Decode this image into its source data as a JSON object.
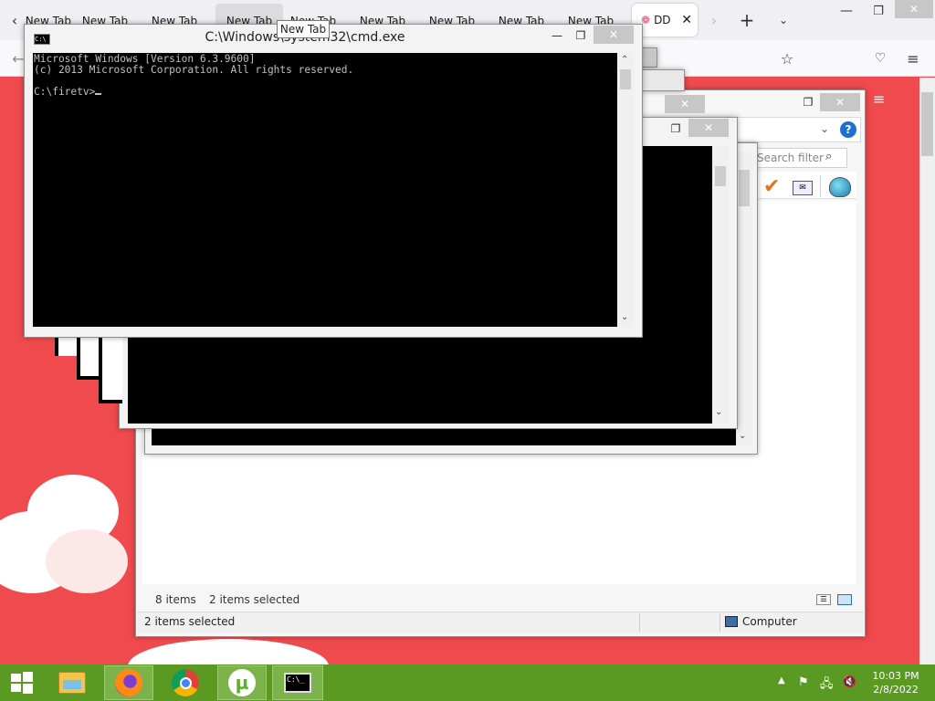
{
  "browser": {
    "tabs": [
      {
        "label": "New Tab"
      },
      {
        "label": "New Tab"
      },
      {
        "label": "New Tab"
      },
      {
        "label": "New Tab"
      },
      {
        "label": "New Tab"
      },
      {
        "label": "New Tab"
      },
      {
        "label": "New Tab"
      },
      {
        "label": "New Tab"
      },
      {
        "label": "New Tab"
      }
    ],
    "active_tab_label": "DD",
    "tooltip": "New Tab",
    "accent_color": "#ef4b4e"
  },
  "cmd": {
    "title": "C:\\Windows\\system32\\cmd.exe",
    "line1": "Microsoft Windows [Version 6.3.9600]",
    "line2": "(c) 2013 Microsoft Corporation. All rights reserved.",
    "prompt": "C:\\firetv>"
  },
  "explorer": {
    "search_placeholder": "Search filter",
    "item_count": "8 items",
    "selected_count": "2 items selected",
    "status_selected": "2 items selected",
    "status_location": "Computer"
  },
  "taskbar": {
    "time": "10:03 PM",
    "date": "2/8/2022"
  }
}
